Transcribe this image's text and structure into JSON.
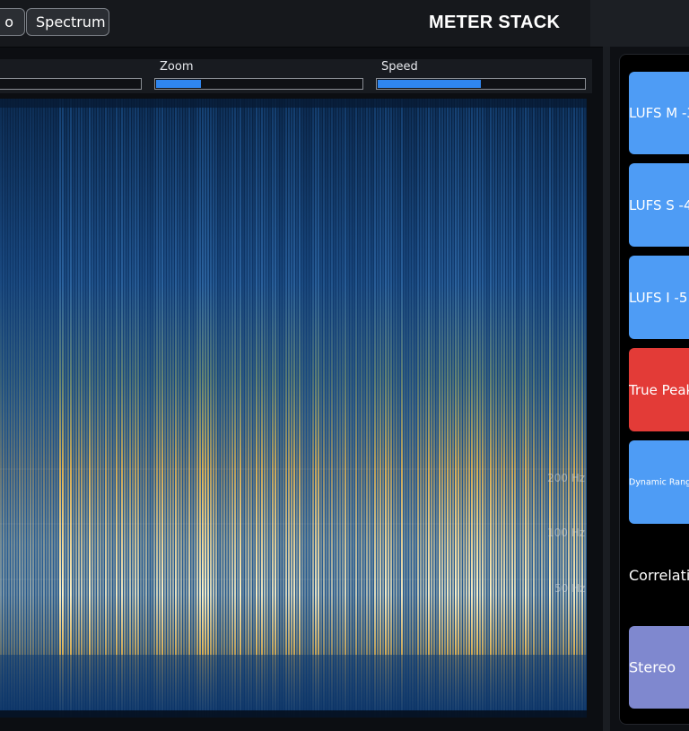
{
  "toolbar": {
    "button_partial_label": "o",
    "spectrum_label": "Spectrum",
    "title": "METER STACK"
  },
  "controls": {
    "zoom_label": "Zoom",
    "zoom_value": 0.22,
    "speed_label": "Speed",
    "speed_value": 0.5
  },
  "spectrogram": {
    "freq_labels": [
      "200 Hz",
      "100 Hz",
      "50 Hz"
    ],
    "colors": {
      "low": "#0a2a55",
      "mid": "#2f6fb0",
      "high": "#f0b94a",
      "peak": "#fff3c8"
    }
  },
  "meters": {
    "lufs_m": "LUFS M -3",
    "lufs_s": "LUFS S -4",
    "lufs_i": "LUFS I -5.",
    "true_peak": "True Peak",
    "dynamic_range": "Dynamic Rang",
    "correlation": "Correlati",
    "stereo": "Stereo"
  },
  "colors": {
    "accent": "#4e9cf5",
    "alert": "#e33b37",
    "stereo": "#7f88cf",
    "slider_fill": "#2f86f0"
  }
}
